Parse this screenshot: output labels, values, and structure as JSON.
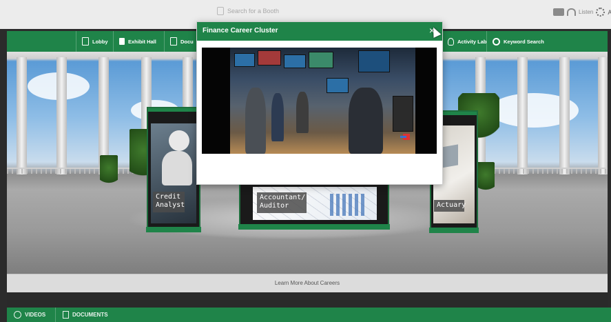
{
  "topbar": {
    "search_placeholder": "Search for a Booth",
    "right_label": "Listen",
    "right_letter": "A"
  },
  "nav": {
    "items": [
      {
        "label": "Lobby",
        "icon": "building-icon"
      },
      {
        "label": "Exhibit Hall",
        "icon": "flag-icon"
      },
      {
        "label": "Docu",
        "icon": "document-icon"
      },
      {
        "label": "Activity Lab",
        "icon": "lightbulb-icon"
      },
      {
        "label": "Keyword Search",
        "icon": "search-icon"
      }
    ]
  },
  "booths": [
    {
      "label": "Credit\nAnalyst"
    },
    {
      "label": "Accountant/\nAuditor"
    },
    {
      "label": "Actuary"
    }
  ],
  "learn_more": "Learn More About Careers",
  "bottom_tabs": [
    {
      "label": "VIDEOS",
      "icon": "play-icon"
    },
    {
      "label": "DOCUMENTS",
      "icon": "document-icon"
    }
  ],
  "modal": {
    "title": "Finance Career Cluster",
    "close_symbol": "×"
  },
  "colors": {
    "brand_green": "#1f8449",
    "modal_bg": "#ffffff"
  }
}
